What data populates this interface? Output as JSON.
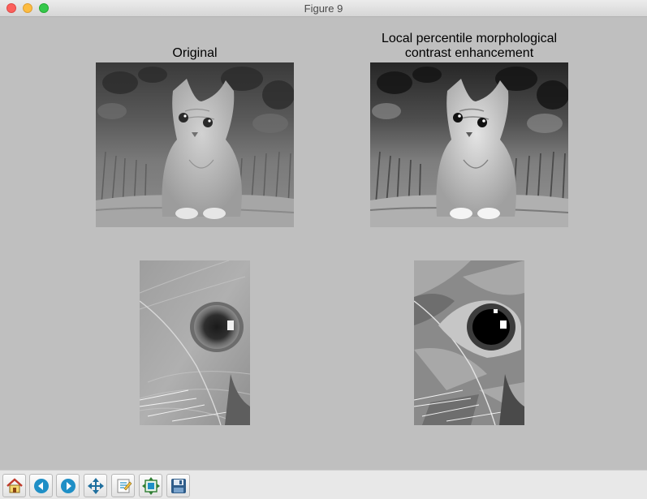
{
  "window": {
    "title": "Figure 9"
  },
  "figure": {
    "panels": [
      {
        "title": "Original",
        "content": "grayscale photo of a kitten sitting on a rock"
      },
      {
        "title": "Local percentile morphological\ncontrast enhancement",
        "content": "contrast-enhanced grayscale photo of the kitten"
      },
      {
        "title": "",
        "content": "zoomed crop of the kitten's eye"
      },
      {
        "title": "",
        "content": "zoomed crop of the kitten's eye after contrast enhancement"
      }
    ]
  },
  "toolbar": {
    "buttons": [
      {
        "name": "home",
        "icon": "home-icon"
      },
      {
        "name": "back",
        "icon": "back-arrow-icon"
      },
      {
        "name": "forward",
        "icon": "forward-arrow-icon"
      },
      {
        "name": "pan",
        "icon": "pan-move-icon"
      },
      {
        "name": "zoom",
        "icon": "zoom-rect-icon"
      },
      {
        "name": "configure-subplots",
        "icon": "subplots-icon"
      },
      {
        "name": "save",
        "icon": "save-disk-icon"
      }
    ]
  }
}
